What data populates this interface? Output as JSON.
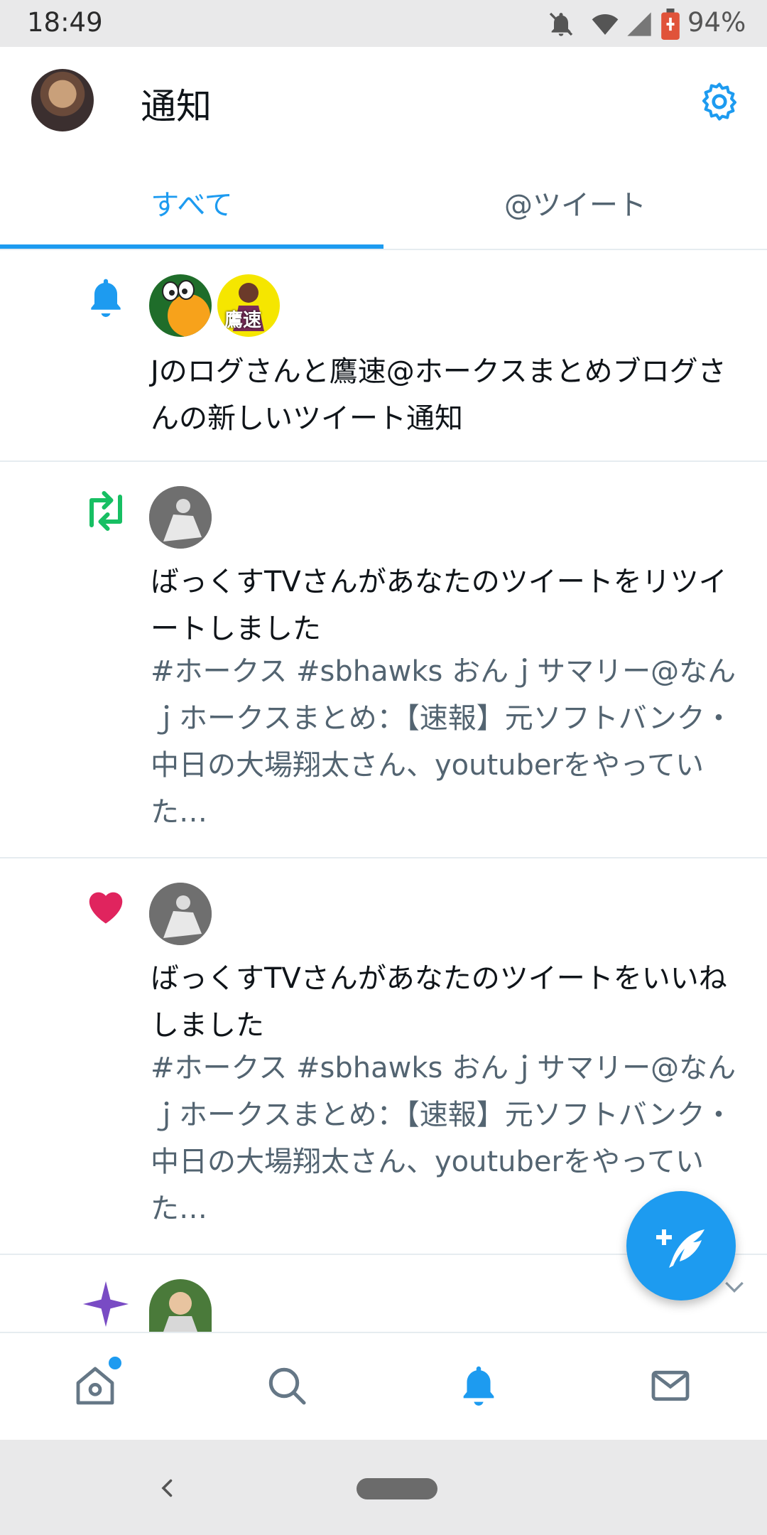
{
  "status_bar": {
    "time": "18:49",
    "battery": "94%",
    "icons": [
      "notifications-off-icon",
      "wifi-icon",
      "cellular-icon",
      "battery-icon"
    ]
  },
  "header": {
    "title": "通知",
    "avatar_icon": "profile-avatar",
    "settings_icon": "gear-icon"
  },
  "tabs": [
    {
      "label": "すべて",
      "selected": true
    },
    {
      "label": "@ツイート",
      "selected": false
    }
  ],
  "notifications": [
    {
      "type_icon": "bell-icon",
      "text": "Jのログさんと鷹速@ホークスまとめブログさんの新しいツイート通知",
      "avatar_badge": "鷹速"
    },
    {
      "type_icon": "retweet-icon",
      "text": "ばっくすTVさんがあなたのツイートをリツイートしました",
      "preview": "#ホークス #sbhawks おんｊサマリー@なんｊホークスまとめ：【速報】元ソフトバンク・中日の大場翔太さん、youtuberをやっていた…"
    },
    {
      "type_icon": "heart-icon",
      "text": "ばっくすTVさんがあなたのツイートをいいねしました",
      "preview": "#ホークス #sbhawks おんｊサマリー@なんｊホークスまとめ：【速報】元ソフトバンク・中日の大場翔太さん、youtuberをやっていた…"
    },
    {
      "type_icon": "sparkle-icon"
    }
  ],
  "bottom_nav": [
    {
      "name": "home-icon",
      "active": false,
      "badge": true
    },
    {
      "name": "search-icon",
      "active": false
    },
    {
      "name": "notifications-bell-icon",
      "active": true
    },
    {
      "name": "messages-icon",
      "active": false
    }
  ],
  "colors": {
    "accent": "#1d9bf0",
    "retweet": "#17bf63",
    "like": "#e0245e",
    "sparkle": "#794bc4",
    "secondary_text": "#536471"
  }
}
